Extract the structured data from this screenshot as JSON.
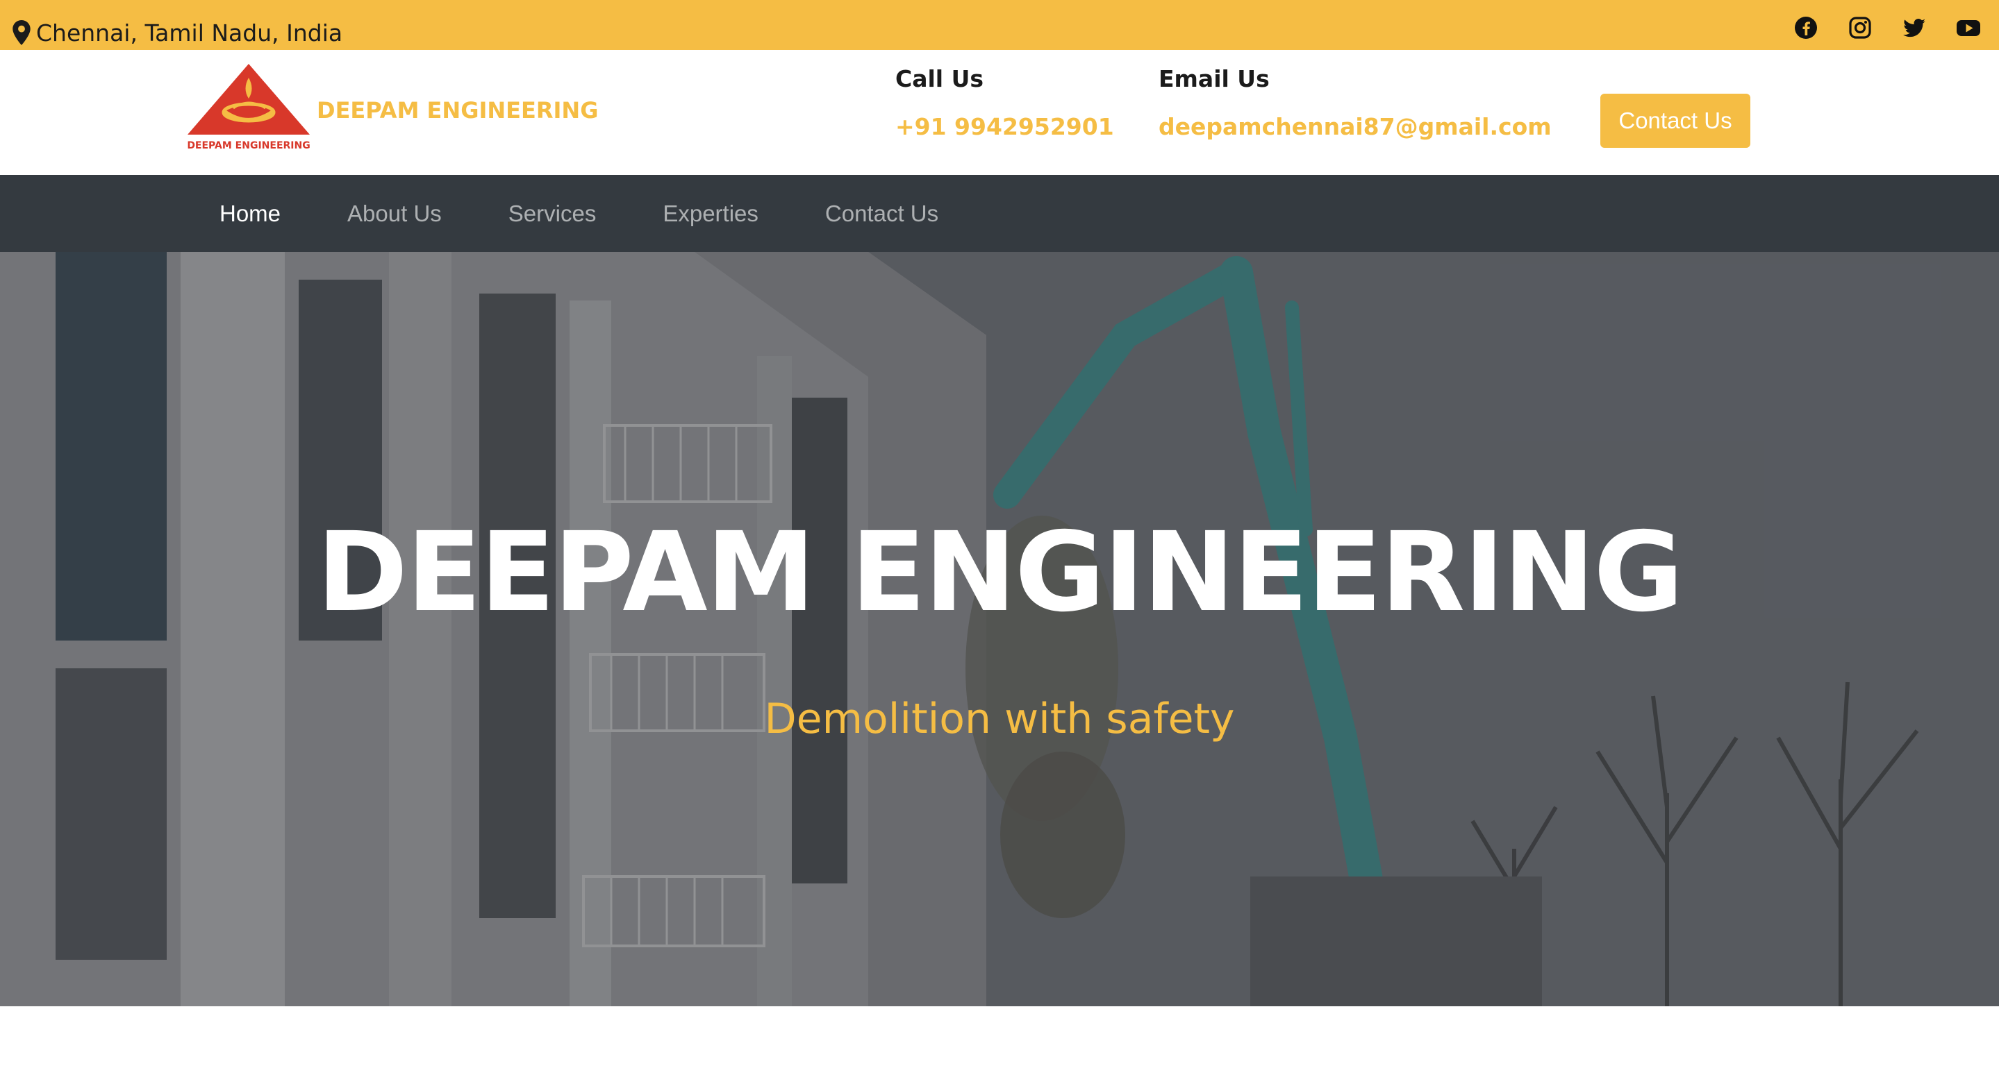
{
  "topbar": {
    "location": "Chennai, Tamil Nadu, India",
    "location_icon": "map-pin-icon",
    "socials": [
      {
        "name": "facebook",
        "icon": "facebook-icon"
      },
      {
        "name": "instagram",
        "icon": "instagram-icon"
      },
      {
        "name": "twitter",
        "icon": "twitter-icon"
      },
      {
        "name": "youtube",
        "icon": "youtube-icon"
      }
    ],
    "background_color": "#f5bd44"
  },
  "header": {
    "logo_caption": "DEEPAM ENGINEERING",
    "brand_name": "DEEPAM ENGINEERING",
    "call_label": "Call Us",
    "call_value": "+91 9942952901",
    "email_label": "Email Us",
    "email_value": "deepamchennai87@gmail.com",
    "contact_button": "Contact Us"
  },
  "nav": {
    "items": [
      {
        "label": "Home",
        "active": true
      },
      {
        "label": "About Us",
        "active": false
      },
      {
        "label": "Services",
        "active": false
      },
      {
        "label": "Experties",
        "active": false
      },
      {
        "label": "Contact Us",
        "active": false
      }
    ],
    "background_color": "#343a40"
  },
  "hero": {
    "title": "DEEPAM ENGINEERING",
    "subtitle": "Demolition with safety",
    "accent_color": "#f5bd44"
  }
}
